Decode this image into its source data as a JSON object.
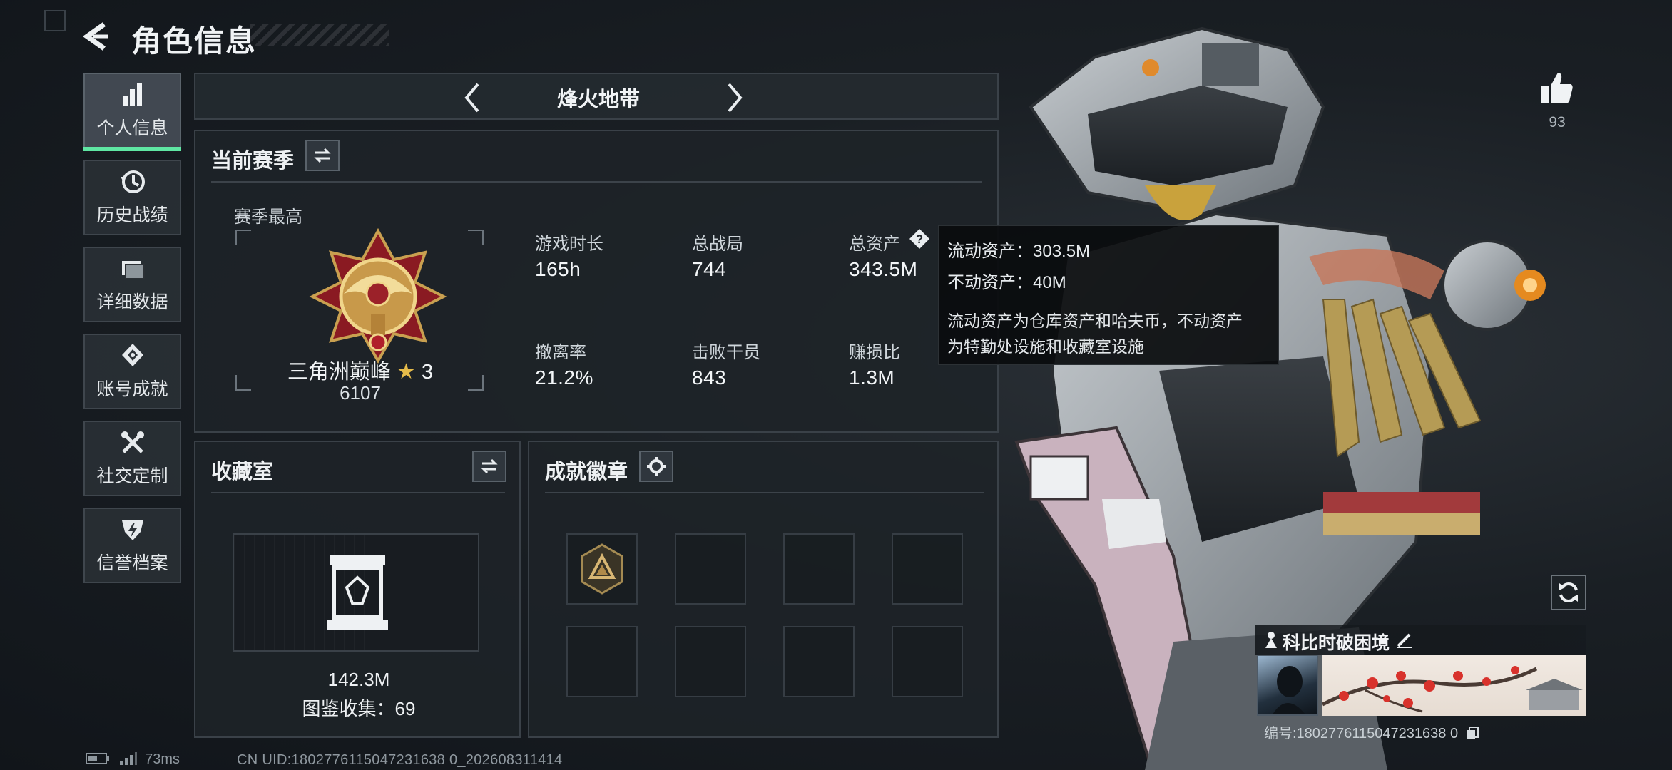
{
  "header": {
    "title": "角色信息"
  },
  "sidebar": {
    "items": [
      {
        "label": "个人信息",
        "icon": "bar-chart-icon",
        "active": true
      },
      {
        "label": "历史战绩",
        "icon": "clock-history-icon"
      },
      {
        "label": "详细数据",
        "icon": "folder-data-icon"
      },
      {
        "label": "账号成就",
        "icon": "medal-icon"
      },
      {
        "label": "社交定制",
        "icon": "tools-icon"
      },
      {
        "label": "信誉档案",
        "icon": "shield-bolt-icon"
      }
    ]
  },
  "mode": {
    "title": "烽火地带"
  },
  "season": {
    "title": "当前赛季",
    "best_label": "赛季最高",
    "rank_name": "三角洲巅峰",
    "rank_stars": "3",
    "rank_score": "6107",
    "stats": [
      {
        "label": "游戏时长",
        "value": "165h"
      },
      {
        "label": "总战局",
        "value": "744"
      },
      {
        "label": "总资产",
        "value": "343.5M"
      },
      {
        "label": "撤离率",
        "value": "21.2%"
      },
      {
        "label": "击败干员",
        "value": "843"
      },
      {
        "label": "赚损比",
        "value": "1.3M"
      }
    ]
  },
  "tooltip": {
    "liquid": "流动资产：303.5M",
    "fixed": "不动资产：40M",
    "desc_1": "流动资产为仓库资产和哈夫币，不动资产",
    "desc_2": "为特勤处设施和收藏室设施"
  },
  "collection": {
    "title": "收藏室",
    "value": "142.3M",
    "catalog": "图鉴收集：69"
  },
  "achievements": {
    "title": "成就徽章"
  },
  "profile": {
    "likes": "93",
    "nickname": "科比时破困境",
    "id_label": "编号:1802776115047231638 0"
  },
  "footer": {
    "ping": "73ms",
    "uid": "CN UID:1802776115047231638 0_202608311414"
  },
  "colors": {
    "accent": "#5fe6a3",
    "panel": "#1e2328",
    "border": "#3a4148"
  }
}
